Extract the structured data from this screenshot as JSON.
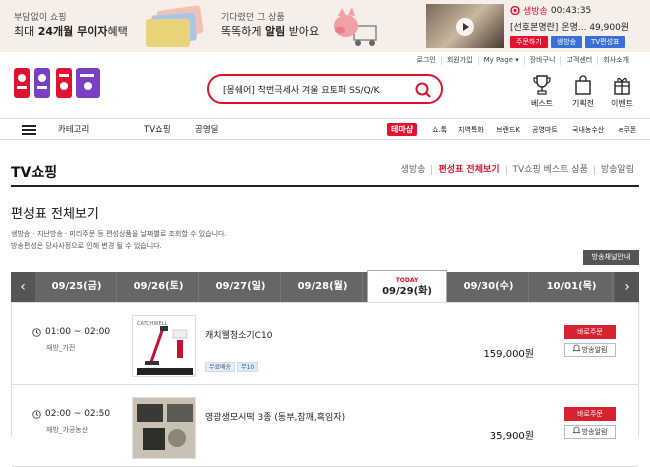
{
  "banner1": {
    "line1": "부담없이 쇼핑",
    "line2_prefix": "최대 ",
    "line2_bold": "24개월 무이자",
    "line2_suffix": "혜택"
  },
  "banner2": {
    "line1": "기다렸던 그 상품",
    "line2_prefix": "똑똑하게 ",
    "line2_bold": "알림",
    "line2_suffix": " 받아요"
  },
  "live": {
    "badge": "생방송",
    "time": "00:43:35",
    "product": "[선호본명란] 온명...",
    "price": "49,900원",
    "btn_order": "주문하기",
    "btn_live": "생방송",
    "btn_schedule": "TV편성표"
  },
  "util_links": [
    "로그인",
    "회원가입",
    "My Page ▾",
    "장바구니",
    "고객센터",
    "회사소개"
  ],
  "search": {
    "query": "[몽쉐어] 착번극세사 겨울 요토퍼 SS/Q/K"
  },
  "header_icons": {
    "best": "베스트",
    "special": "기획전",
    "event": "이벤트"
  },
  "nav": {
    "category": "카테고리",
    "tv": "TV쇼핑",
    "deal": "공영딜",
    "theme_badge": "테마샵",
    "theme_items": [
      "쇼.톡",
      "지역특화",
      "브랜드K",
      "공영마트",
      "국내농수산",
      "e쿠폰"
    ]
  },
  "page": {
    "title": "TV쇼핑",
    "subnav": [
      "생방송",
      "편성표 전체보기",
      "TV쇼핑 베스트 상품",
      "방송알림"
    ],
    "section_title": "편성표 전체보기",
    "desc1": "생방송 · 지난방송 · 미리주문 등 편성상품을 날짜별로 조회할 수 있습니다.",
    "desc2": "방송편성은 당사사정으로 인해 변경 될 수 있습니다.",
    "channel_btn": "방송채널안내"
  },
  "dates": [
    "09/25(금)",
    "09/26(토)",
    "09/27(일)",
    "09/28(월)",
    "09/29(화)",
    "09/30(수)",
    "10/01(목)"
  ],
  "today_label": "TODAY",
  "rows": [
    {
      "time": "01:00 ~ 02:00",
      "channel": "재방_가전",
      "name": "캐치웰청소기C10",
      "tags": [
        "무료배송",
        "무10"
      ],
      "price": "159,000원",
      "buy": "바로주문",
      "alarm": "방송알림"
    },
    {
      "time": "02:00 ~ 02:50",
      "channel": "재방_가공농산",
      "name": "영광생모시떡 3종 (동부,참깨,흑임자)",
      "tags": [],
      "price": "35,900원",
      "buy": "바로주문",
      "alarm": "방송알림"
    }
  ],
  "colors": {
    "accent": "#e0122f",
    "banner_bg": "#f6efe9",
    "datebar": "#666666"
  }
}
